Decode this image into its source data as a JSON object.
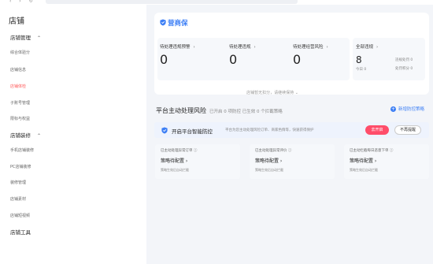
{
  "sidebar": {
    "title": "店铺",
    "groups": [
      {
        "label": "店铺管理",
        "caret": "⌃"
      },
      {
        "label": "店铺装修",
        "caret": "⌃"
      },
      {
        "label": "店铺工具"
      }
    ],
    "items": [
      {
        "label": "综合体验分"
      },
      {
        "label": "店铺信息"
      },
      {
        "label": "店铺体检"
      },
      {
        "label": "子账号管理"
      },
      {
        "label": "限标与权益"
      },
      {
        "label": "手机店铺装修"
      },
      {
        "label": "PC店铺装修"
      },
      {
        "label": "装修管理"
      },
      {
        "label": "店铺素材"
      },
      {
        "label": "店铺短视频"
      }
    ],
    "active_item": "店铺体检"
  },
  "header": {
    "brand": "营商保",
    "stats": [
      {
        "label": "待处理违规预警",
        "value": "0"
      },
      {
        "label": "待处理违规",
        "value": "0"
      },
      {
        "label": "待处理经营风险",
        "value": "0"
      }
    ],
    "pending": {
      "label": "全部违规",
      "value": "8",
      "today": "今日 0",
      "appeal": "违规处罚 0",
      "penalty": "处罚积分 0"
    },
    "footer": "店铺暂无扣分，请继续保持 ⌄"
  },
  "risk": {
    "title": "平台主动处理风险",
    "subtitle": "已开启 0 项防控 已生效 0 个拦截策略",
    "add_label": "新增防控策略"
  },
  "banner": {
    "title": "开启平台智能防控",
    "subtitle": "平台为您主动处理风险订单、商家色情等，快速获得保护",
    "open_label": "去开启",
    "later_label": "不再提醒"
  },
  "policies": [
    {
      "title": "已主动处理异常订单 ⓘ",
      "status": "策略待配置 ›",
      "desc": "策略生效后自动拦截"
    },
    {
      "title": "已主动处理异常评价 ⓘ",
      "status": "策略待配置 ›",
      "desc": "策略生效后自动拦截"
    },
    {
      "title": "已主动拦截每日恶意下单 ⓘ",
      "status": "策略待配置 ›",
      "desc": "策略生效后自动拦截"
    }
  ],
  "colors": {
    "accent": "#3d7ff5",
    "active": "#ff5c5c",
    "danger": "#ff4d6a"
  }
}
